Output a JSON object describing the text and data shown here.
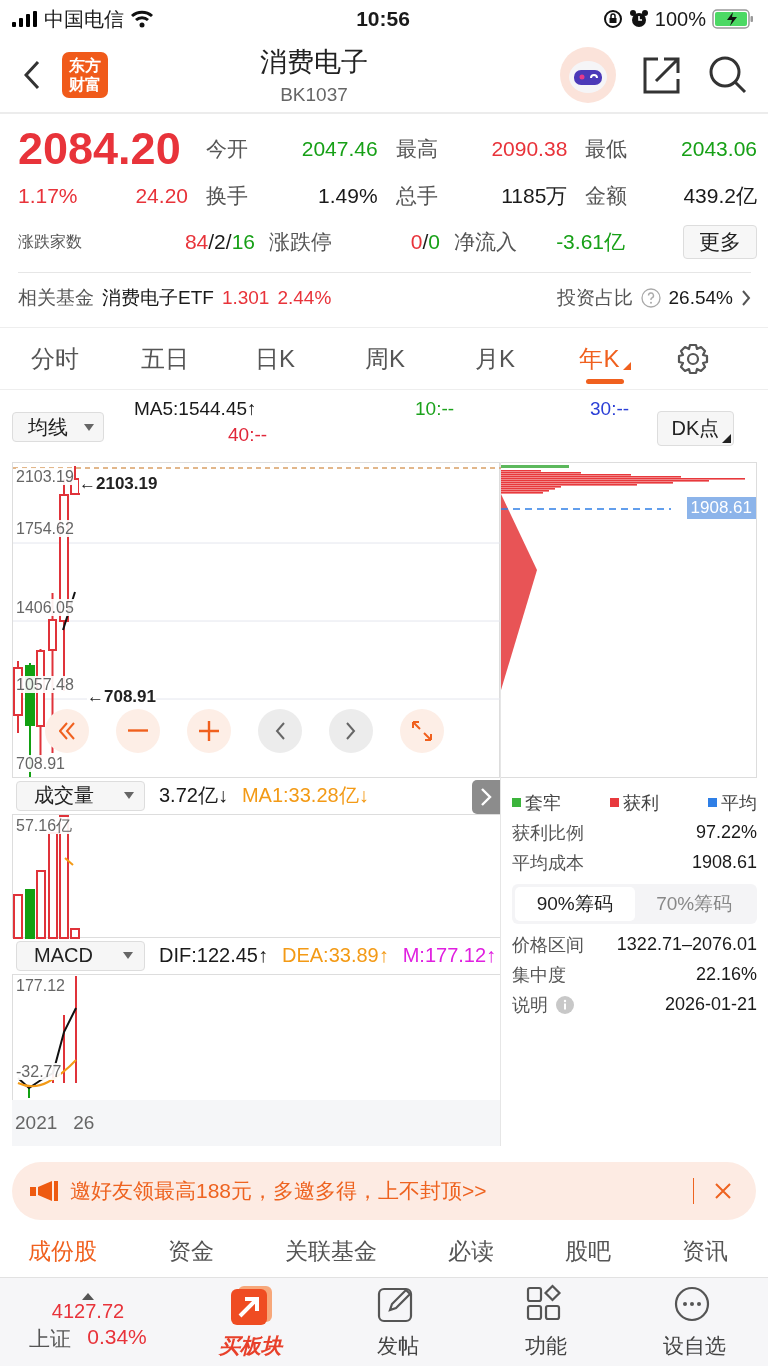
{
  "status_bar": {
    "carrier": "中国电信",
    "time": "10:56",
    "battery": "100%"
  },
  "header": {
    "logo": [
      "东方",
      "财富"
    ],
    "title": "消费电子",
    "code": "BK1037"
  },
  "quote": {
    "price": "2084.20",
    "change_pct": "1.17%",
    "change": "24.20",
    "color": "#e8333a",
    "stats": [
      {
        "label": "今开",
        "value": "2047.46",
        "color": "#17a017"
      },
      {
        "label": "最高",
        "value": "2090.38",
        "color": "#e8333a"
      },
      {
        "label": "最低",
        "value": "2043.06",
        "color": "#17a017"
      },
      {
        "label": "换手",
        "value": "1.49%",
        "color": "#1a1a1a"
      },
      {
        "label": "总手",
        "value": "1185万",
        "color": "#1a1a1a"
      },
      {
        "label": "金额",
        "value": "439.2亿",
        "color": "#1a1a1a"
      }
    ],
    "breadth": {
      "label": "涨跌家数",
      "parts": [
        {
          "text": "84",
          "color": "#e8333a"
        },
        {
          "text": "/2/",
          "color": "#1a1a1a"
        },
        {
          "text": "16",
          "color": "#17a017"
        }
      ]
    },
    "limit": {
      "label": "涨跌停",
      "parts": [
        {
          "text": "0",
          "color": "#e8333a"
        },
        {
          "text": "/",
          "color": "#1a1a1a"
        },
        {
          "text": "0",
          "color": "#17a017"
        }
      ]
    },
    "inflow": {
      "label": "净流入",
      "value": "-3.61亿",
      "color": "#17a017"
    },
    "more_button": "更多"
  },
  "fund": {
    "label": "相关基金",
    "name": "消费电子ETF",
    "price": "1.301",
    "pct": "2.44%",
    "ratio_label": "投资占比",
    "ratio": "26.54%"
  },
  "period_tabs": [
    {
      "label": "分时",
      "selected": false
    },
    {
      "label": "五日",
      "selected": false
    },
    {
      "label": "日K",
      "selected": false
    },
    {
      "label": "周K",
      "selected": false
    },
    {
      "label": "月K",
      "selected": false
    },
    {
      "label": "年K",
      "selected": true
    }
  ],
  "indicator": {
    "selector": "均线",
    "lines": [
      {
        "text": "MA5:1544.45↑",
        "color": "#1a1a1a"
      },
      {
        "text": "10:--",
        "color": "#1ca21c"
      },
      {
        "text": "30:--",
        "color": "#2b3fd6"
      },
      {
        "text": "40:--",
        "color": "#e0283a"
      }
    ],
    "dk_button": "DK点"
  },
  "main_chart": {
    "axis_labels": [
      "2103.19",
      "1754.62",
      "1406.05",
      "1057.48",
      "708.91"
    ],
    "high_marker": "←2103.19",
    "low_marker": "←708.91",
    "controls": [
      {
        "kind": "rewind",
        "disabled": false
      },
      {
        "kind": "minus",
        "disabled": false
      },
      {
        "kind": "plus",
        "disabled": false
      },
      {
        "kind": "prev",
        "disabled": true
      },
      {
        "kind": "next",
        "disabled": true
      },
      {
        "kind": "expand",
        "disabled": false
      }
    ]
  },
  "chip": {
    "avg_label": "1908.61",
    "legend": [
      {
        "label": "套牢",
        "color": "#3cb43c"
      },
      {
        "label": "获利",
        "color": "#e8393d"
      },
      {
        "label": "平均",
        "color": "#2f7fe6"
      }
    ],
    "rows_top": [
      {
        "label": "获利比例",
        "value": "97.22%"
      },
      {
        "label": "平均成本",
        "value": "1908.61"
      }
    ],
    "segments": [
      {
        "label": "90%筹码",
        "selected": true
      },
      {
        "label": "70%筹码",
        "selected": false
      }
    ],
    "rows_bottom": [
      {
        "label": "价格区间",
        "value": "1322.71–2076.01"
      },
      {
        "label": "集中度",
        "value": "22.16%"
      },
      {
        "label": "说明",
        "value": "2026-01-21",
        "info": true
      }
    ]
  },
  "volume": {
    "selector": "成交量",
    "value": "3.72亿↓",
    "ma": "MA1:33.28亿↓",
    "axis_label": "57.16亿"
  },
  "macd": {
    "selector": "MACD",
    "dif": "DIF:122.45↑",
    "dea": "DEA:33.89↑",
    "m": "M:177.12↑",
    "axis_labels": [
      "177.12",
      "-32.77"
    ]
  },
  "date_axis": [
    "2021",
    "26"
  ],
  "banner": {
    "text": "邀好友领最高188元，多邀多得，上不封顶>>"
  },
  "content_tabs": [
    {
      "label": "成份股",
      "selected": true
    },
    {
      "label": "资金",
      "selected": false
    },
    {
      "label": "关联基金",
      "selected": false
    },
    {
      "label": "必读",
      "selected": false
    },
    {
      "label": "股吧",
      "selected": false
    },
    {
      "label": "资讯",
      "selected": false
    }
  ],
  "bottom_nav": {
    "index": {
      "value": "4127.72",
      "name": "上证",
      "pct": "0.34%",
      "color": "#e8333a"
    },
    "items": [
      {
        "kind": "brand",
        "label": "买板块"
      },
      {
        "kind": "post",
        "label": "发帖"
      },
      {
        "kind": "functions",
        "label": "功能"
      },
      {
        "kind": "watch",
        "label": "设自选"
      }
    ]
  }
}
